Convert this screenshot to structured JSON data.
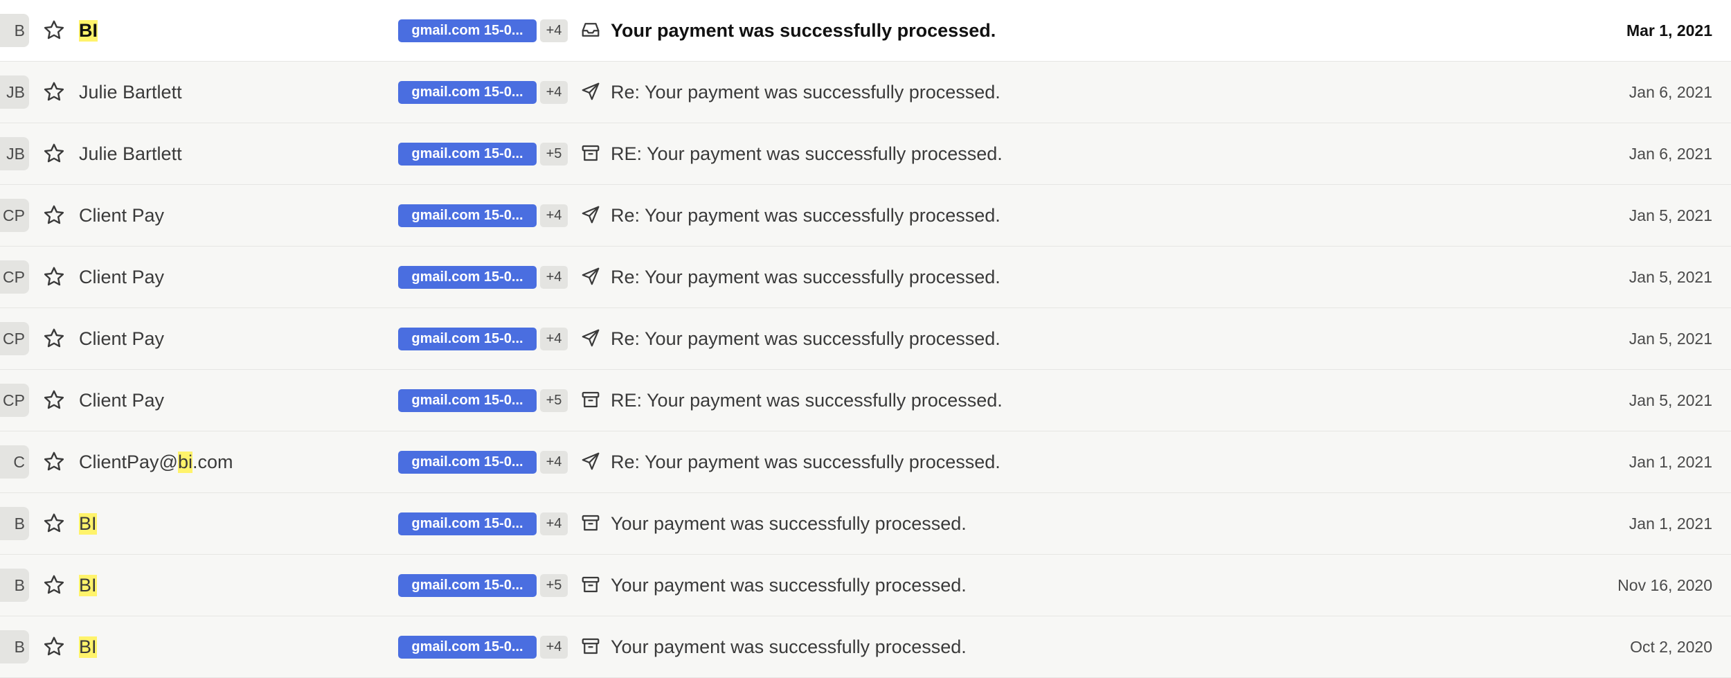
{
  "colors": {
    "accent": "#4a6ee0",
    "highlight": "#fff36b",
    "unread_bg": "#ffffff",
    "read_bg": "#f7f7f5"
  },
  "emails": [
    {
      "initials": "B",
      "sender": [
        {
          "t": "BI",
          "hl": true
        }
      ],
      "tag": "gmail.com 15-0...",
      "more": "+4",
      "icon": "inbox-icon",
      "subject": "Your payment was successfully processed.",
      "date": "Mar 1, 2021",
      "unread": true
    },
    {
      "initials": "JB",
      "sender": [
        {
          "t": "Julie Bartlett",
          "hl": false
        }
      ],
      "tag": "gmail.com 15-0...",
      "more": "+4",
      "icon": "sent-icon",
      "subject": "Re: Your payment was successfully processed.",
      "date": "Jan 6, 2021",
      "unread": false
    },
    {
      "initials": "JB",
      "sender": [
        {
          "t": "Julie Bartlett",
          "hl": false
        }
      ],
      "tag": "gmail.com 15-0...",
      "more": "+5",
      "icon": "archive-icon",
      "subject": "RE: Your payment was successfully processed.",
      "date": "Jan 6, 2021",
      "unread": false
    },
    {
      "initials": "CP",
      "sender": [
        {
          "t": "Client Pay",
          "hl": false
        }
      ],
      "tag": "gmail.com 15-0...",
      "more": "+4",
      "icon": "sent-icon",
      "subject": "Re: Your payment was successfully processed.",
      "date": "Jan 5, 2021",
      "unread": false
    },
    {
      "initials": "CP",
      "sender": [
        {
          "t": "Client Pay",
          "hl": false
        }
      ],
      "tag": "gmail.com 15-0...",
      "more": "+4",
      "icon": "sent-icon",
      "subject": "Re: Your payment was successfully processed.",
      "date": "Jan 5, 2021",
      "unread": false
    },
    {
      "initials": "CP",
      "sender": [
        {
          "t": "Client Pay",
          "hl": false
        }
      ],
      "tag": "gmail.com 15-0...",
      "more": "+4",
      "icon": "sent-icon",
      "subject": "Re: Your payment was successfully processed.",
      "date": "Jan 5, 2021",
      "unread": false
    },
    {
      "initials": "CP",
      "sender": [
        {
          "t": "Client Pay",
          "hl": false
        }
      ],
      "tag": "gmail.com 15-0...",
      "more": "+5",
      "icon": "archive-icon",
      "subject": "RE: Your payment was successfully processed.",
      "date": "Jan 5, 2021",
      "unread": false
    },
    {
      "initials": "C",
      "sender": [
        {
          "t": "ClientPay@",
          "hl": false
        },
        {
          "t": "bi",
          "hl": true
        },
        {
          "t": ".com",
          "hl": false
        }
      ],
      "tag": "gmail.com 15-0...",
      "more": "+4",
      "icon": "sent-icon",
      "subject": "Re: Your payment was successfully processed.",
      "date": "Jan 1, 2021",
      "unread": false
    },
    {
      "initials": "B",
      "sender": [
        {
          "t": "BI",
          "hl": true
        }
      ],
      "tag": "gmail.com 15-0...",
      "more": "+4",
      "icon": "archive-icon",
      "subject": "Your payment was successfully processed.",
      "date": "Jan 1, 2021",
      "unread": false
    },
    {
      "initials": "B",
      "sender": [
        {
          "t": "BI",
          "hl": true
        }
      ],
      "tag": "gmail.com 15-0...",
      "more": "+5",
      "icon": "archive-icon",
      "subject": "Your payment was successfully processed.",
      "date": "Nov 16, 2020",
      "unread": false
    },
    {
      "initials": "B",
      "sender": [
        {
          "t": "BI",
          "hl": true
        }
      ],
      "tag": "gmail.com 15-0...",
      "more": "+4",
      "icon": "archive-icon",
      "subject": "Your payment was successfully processed.",
      "date": "Oct 2, 2020",
      "unread": false
    }
  ]
}
